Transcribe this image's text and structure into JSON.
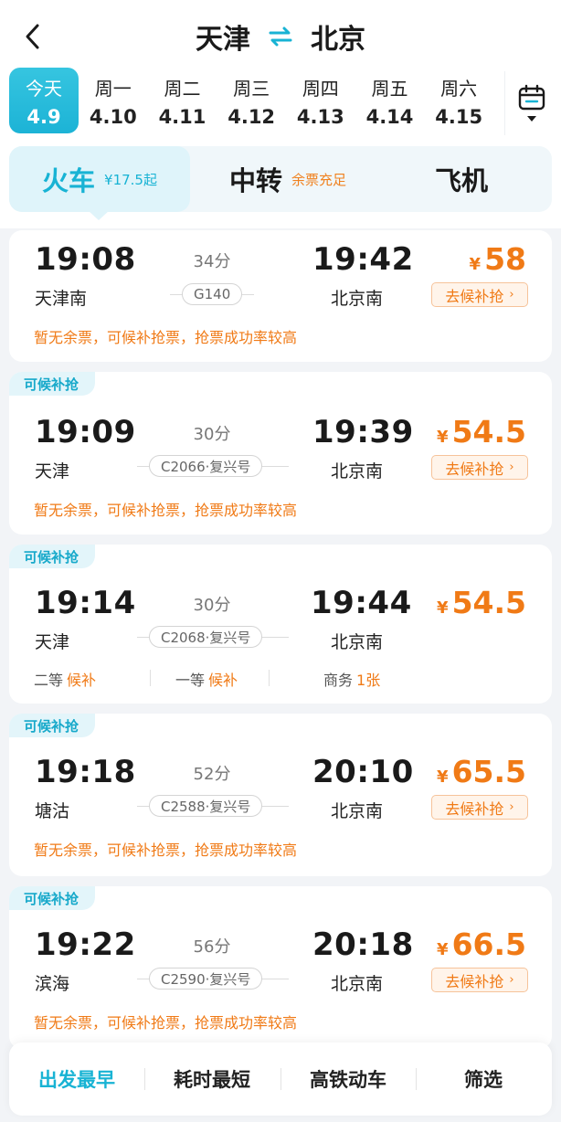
{
  "header": {
    "from": "天津",
    "to": "北京"
  },
  "dates": [
    {
      "day": "今天",
      "date": "4.9",
      "active": true
    },
    {
      "day": "周一",
      "date": "4.10"
    },
    {
      "day": "周二",
      "date": "4.11"
    },
    {
      "day": "周三",
      "date": "4.12"
    },
    {
      "day": "周四",
      "date": "4.13"
    },
    {
      "day": "周五",
      "date": "4.14"
    },
    {
      "day": "周六",
      "date": "4.15"
    }
  ],
  "modes": [
    {
      "label": "火车",
      "sub": "¥17.5起"
    },
    {
      "label": "中转",
      "sub": "余票充足"
    },
    {
      "label": "飞机",
      "sub": ""
    }
  ],
  "trains": [
    {
      "badge": "",
      "dep_time": "19:08",
      "arr_time": "19:42",
      "dep_station": "天津南",
      "arr_station": "北京南",
      "duration": "34分",
      "train_no": "G140",
      "price": "58",
      "currency": "¥",
      "action": "去候补抢",
      "notice": "暂无余票，可候补抢票，抢票成功率较高"
    },
    {
      "badge": "可候补抢",
      "dep_time": "19:09",
      "arr_time": "19:39",
      "dep_station": "天津",
      "arr_station": "北京南",
      "duration": "30分",
      "train_no": "C2066·复兴号",
      "price": "54.5",
      "currency": "¥",
      "action": "去候补抢",
      "notice": "暂无余票，可候补抢票，抢票成功率较高"
    },
    {
      "badge": "可候补抢",
      "dep_time": "19:14",
      "arr_time": "19:44",
      "dep_station": "天津",
      "arr_station": "北京南",
      "duration": "30分",
      "train_no": "C2068·复兴号",
      "price": "54.5",
      "currency": "¥",
      "seats": [
        {
          "name": "二等",
          "value": "候补"
        },
        {
          "name": "一等",
          "value": "候补"
        },
        {
          "name": "商务",
          "value": "1张"
        }
      ]
    },
    {
      "badge": "可候补抢",
      "dep_time": "19:18",
      "arr_time": "20:10",
      "dep_station": "塘沽",
      "arr_station": "北京南",
      "duration": "52分",
      "train_no": "C2588·复兴号",
      "price": "65.5",
      "currency": "¥",
      "action": "去候补抢",
      "notice": "暂无余票，可候补抢票，抢票成功率较高"
    },
    {
      "badge": "可候补抢",
      "dep_time": "19:22",
      "arr_time": "20:18",
      "dep_station": "滨海",
      "arr_station": "北京南",
      "duration": "56分",
      "train_no": "C2590·复兴号",
      "price": "66.5",
      "currency": "¥",
      "action": "去候补抢",
      "notice": "暂无余票，可候补抢票，抢票成功率较高"
    }
  ],
  "bottom_bar": [
    "出发最早",
    "耗时最短",
    "高铁动车",
    "筛选"
  ],
  "colors": {
    "accent": "#18b3d4",
    "price": "#f07a16"
  }
}
